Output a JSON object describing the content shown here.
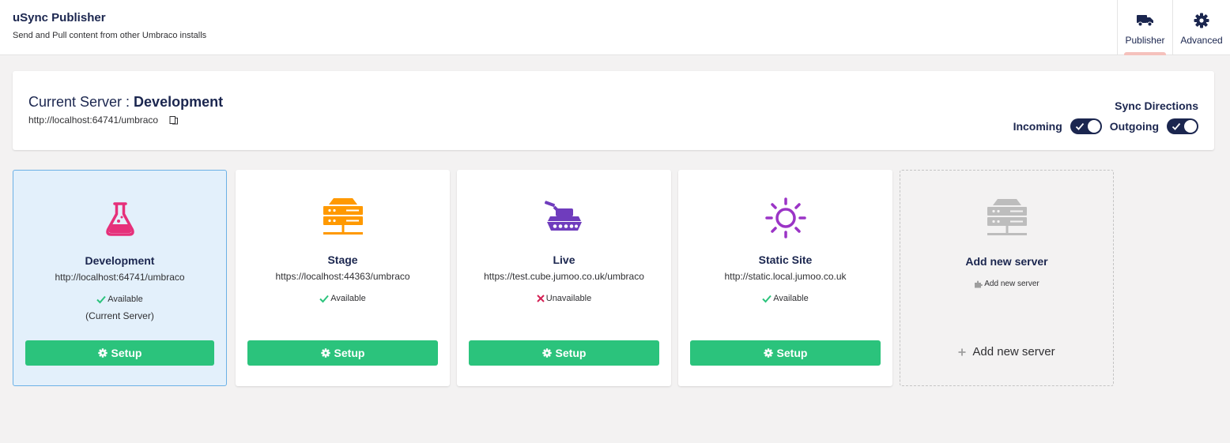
{
  "app": {
    "title": "uSync Publisher",
    "subtitle": "Send and Pull content from other Umbraco installs"
  },
  "tabs": [
    {
      "label": "Publisher",
      "icon": "truck-icon",
      "active": true
    },
    {
      "label": "Advanced",
      "icon": "gear-icon",
      "active": false
    }
  ],
  "current_server": {
    "prefix": "Current Server : ",
    "name": "Development",
    "url": "http://localhost:64741/umbraco"
  },
  "sync": {
    "title": "Sync Directions",
    "incoming_label": "Incoming",
    "outgoing_label": "Outgoing",
    "incoming_enabled": true,
    "outgoing_enabled": true
  },
  "servers": [
    {
      "name": "Development",
      "url": "http://localhost:64741/umbraco",
      "status": "Available",
      "available": true,
      "note": "(Current Server)",
      "icon": "flask-icon",
      "icon_color": "#e6307a",
      "button": "Setup"
    },
    {
      "name": "Stage",
      "url": "https://localhost:44363/umbraco",
      "status": "Available",
      "available": true,
      "icon": "server-icon",
      "icon_color": "#ff9900",
      "button": "Setup"
    },
    {
      "name": "Live",
      "url": "https://test.cube.jumoo.co.uk/umbraco",
      "status": "Unavailable",
      "available": false,
      "icon": "tank-icon",
      "icon_color": "#6f3cbd",
      "button": "Setup"
    },
    {
      "name": "Static Site",
      "url": "http://static.local.jumoo.co.uk",
      "status": "Available",
      "available": true,
      "icon": "sun-icon",
      "icon_color": "#9b34c6",
      "button": "Setup"
    }
  ],
  "add_server": {
    "title": "Add new server",
    "small_link": "Add new server",
    "big_link": "Add new server",
    "icon": "server-icon",
    "icon_color": "#bdbdbd"
  },
  "colors": {
    "primary": "#1b264f",
    "success": "#2bc37c",
    "danger": "#d42054",
    "current_card_bg": "#e3f0fb",
    "current_card_border": "#6bb1e6"
  }
}
